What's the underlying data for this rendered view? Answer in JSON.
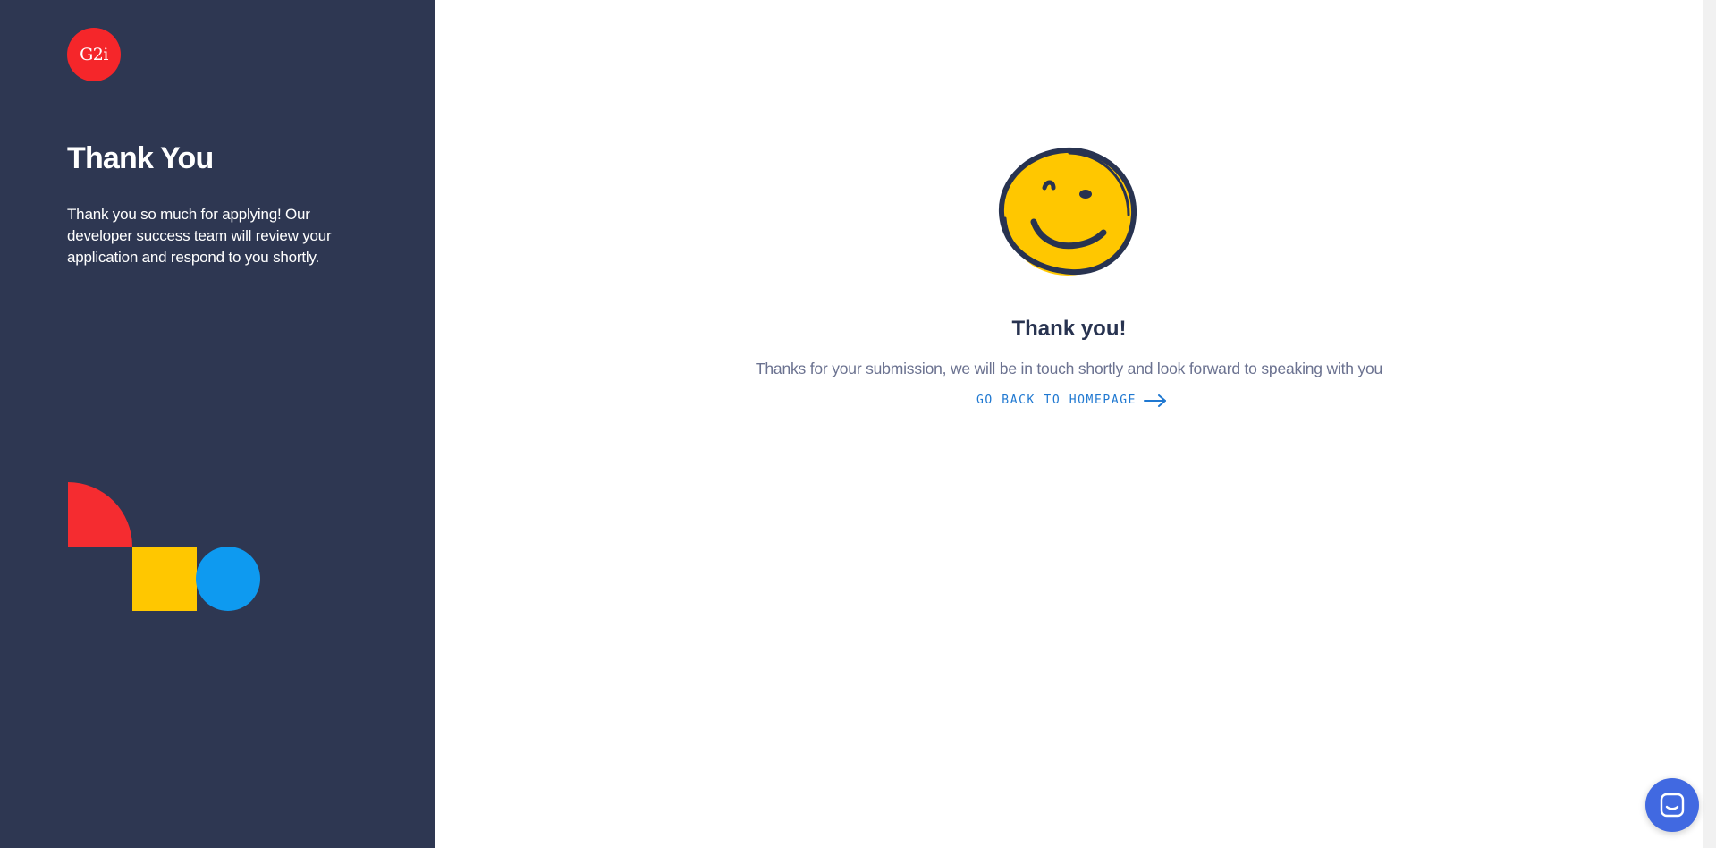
{
  "brand": {
    "logo_text": "G2i",
    "logo_color": "#f5262a"
  },
  "sidebar": {
    "title": "Thank You",
    "text": "Thank you so much for applying! Our developer success team will review your application and respond to you shortly.",
    "background": "#2e3752"
  },
  "main": {
    "title": "Thank you!",
    "message": "Thanks for your submission, we will be in touch shortly and look forward to speaking with you",
    "home_link_label": "GO BACK TO HOMEPAGE"
  },
  "icons": {
    "illustration": "smiley-face-icon",
    "link_arrow": "arrow-right-icon",
    "chat": "chat-icon"
  },
  "colors": {
    "accent_red": "#f52c30",
    "accent_yellow": "#ffc700",
    "accent_blue": "#0e9af0",
    "link": "#1f78d1",
    "chat_button": "#4169e1"
  }
}
